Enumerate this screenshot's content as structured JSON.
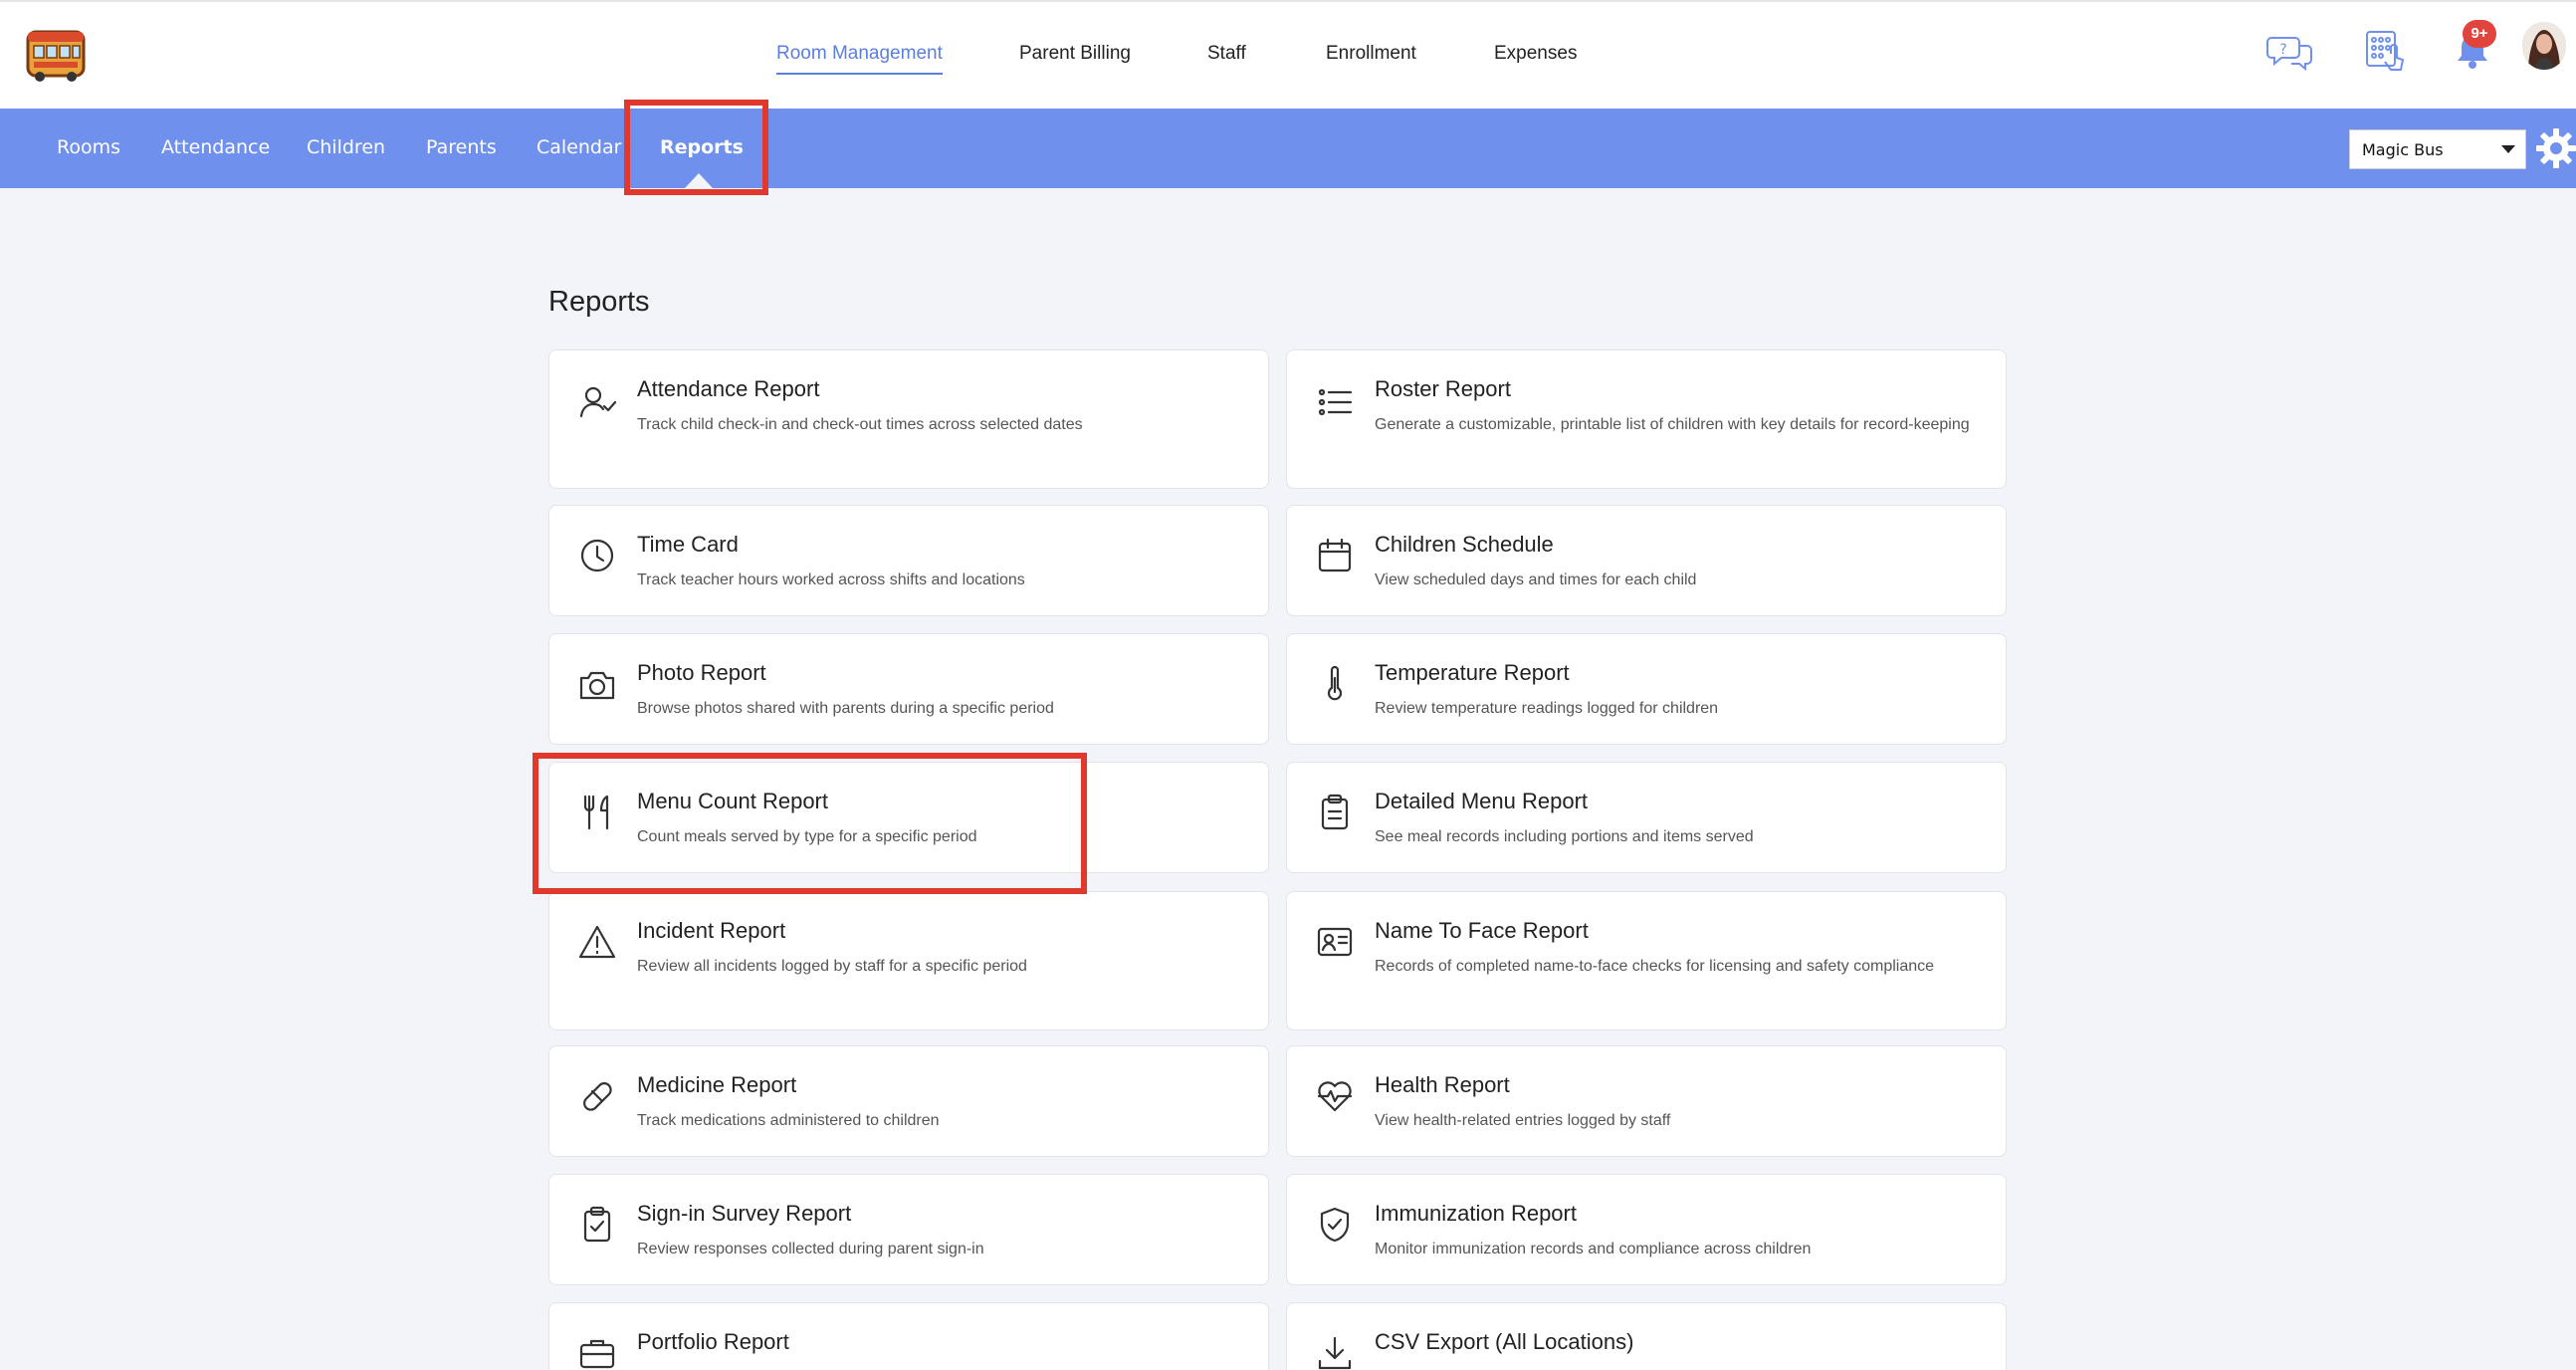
{
  "top_nav": {
    "items": [
      "Room Management",
      "Parent Billing",
      "Staff",
      "Enrollment",
      "Expenses"
    ],
    "active": "Room Management",
    "notification_badge": "9+"
  },
  "sub_nav": {
    "items": [
      "Rooms",
      "Attendance",
      "Children",
      "Parents",
      "Calendar",
      "Reports"
    ],
    "active": "Reports",
    "location_select": "Magic Bus"
  },
  "icons": {
    "help_chat": "help-chat-icon",
    "kiosk": "kiosk-keypad-icon",
    "notifications": "bell-icon",
    "settings": "gear-icon"
  },
  "colors": {
    "accent": "#5b7fe0",
    "subnav_bg": "#6f90ed",
    "highlight": "#e0382c",
    "badge": "#e0443c"
  },
  "page": {
    "title": "Reports"
  },
  "reports": [
    {
      "title": "Attendance Report",
      "desc": "Track child check-in and check-out times across selected dates",
      "icon": "user-check-icon"
    },
    {
      "title": "Roster Report",
      "desc": "Generate a customizable, printable list of children with key details for record-keeping",
      "icon": "list-icon"
    },
    {
      "title": "Time Card",
      "desc": "Track teacher hours worked across shifts and locations",
      "icon": "clock-icon"
    },
    {
      "title": "Children Schedule",
      "desc": "View scheduled days and times for each child",
      "icon": "calendar-icon"
    },
    {
      "title": "Photo Report",
      "desc": "Browse photos shared with parents during a specific period",
      "icon": "camera-icon"
    },
    {
      "title": "Temperature Report",
      "desc": "Review temperature readings logged for children",
      "icon": "thermometer-icon"
    },
    {
      "title": "Menu Count Report",
      "desc": "Count meals served by type for a specific period",
      "icon": "utensils-icon"
    },
    {
      "title": "Detailed Menu Report",
      "desc": "See meal records including portions and items served",
      "icon": "clipboard-icon"
    },
    {
      "title": "Incident Report",
      "desc": "Review all incidents logged by staff for a specific period",
      "icon": "warning-icon"
    },
    {
      "title": "Name To Face Report",
      "desc": "Records of completed name-to-face checks for licensing and safety compliance",
      "icon": "id-card-icon"
    },
    {
      "title": "Medicine Report",
      "desc": "Track medications administered to children",
      "icon": "pill-icon"
    },
    {
      "title": "Health Report",
      "desc": "View health-related entries logged by staff",
      "icon": "heartbeat-icon"
    },
    {
      "title": "Sign-in Survey Report",
      "desc": "Review responses collected during parent sign-in",
      "icon": "clipboard-check-icon"
    },
    {
      "title": "Immunization Report",
      "desc": "Monitor immunization records and compliance across children",
      "icon": "shield-check-icon"
    },
    {
      "title": "Portfolio Report",
      "desc": "",
      "icon": "briefcase-icon"
    },
    {
      "title": "CSV Export (All Locations)",
      "desc": "",
      "icon": "download-icon"
    }
  ]
}
